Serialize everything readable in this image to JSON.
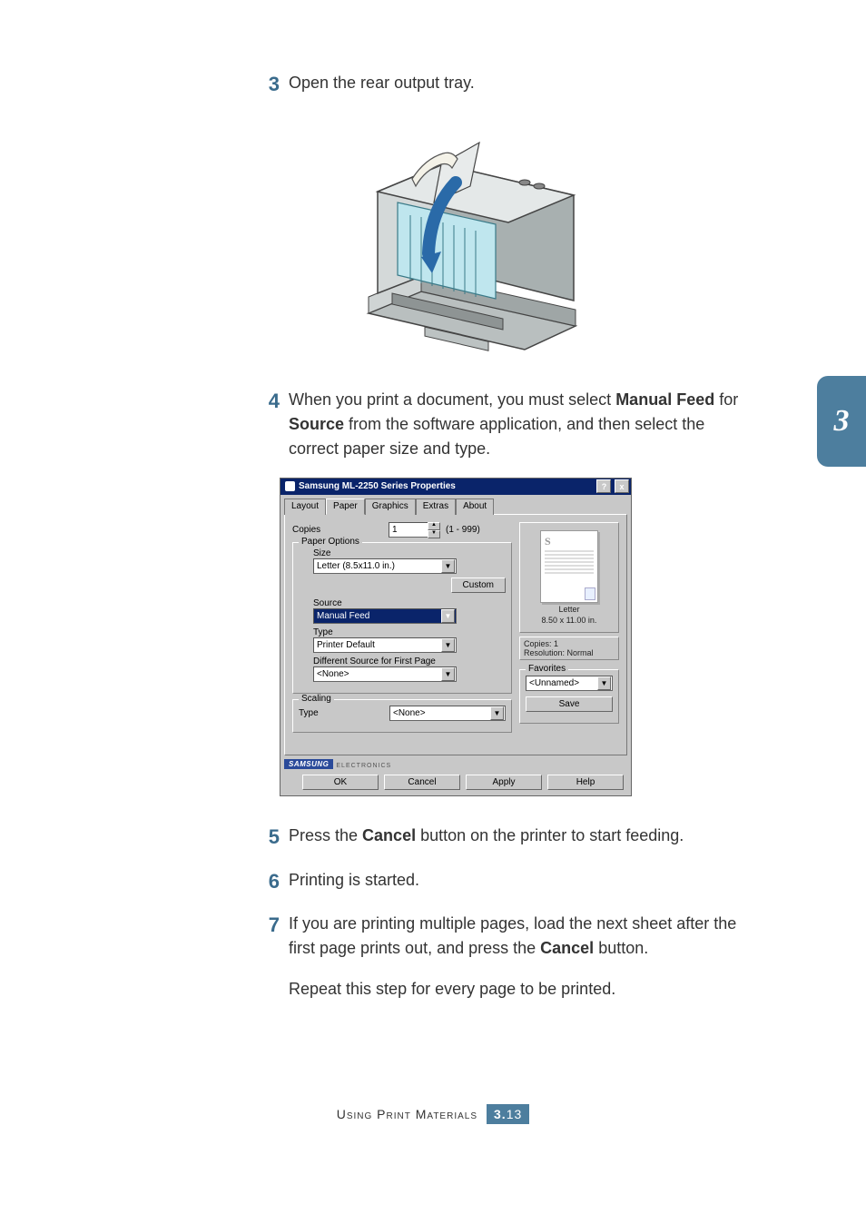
{
  "sideTab": "3",
  "steps": {
    "s3": {
      "num": "3",
      "text": "Open the rear output tray."
    },
    "s4": {
      "num": "4",
      "pre": "When you print a document, you must select ",
      "bold1": "Manual Feed",
      "mid": " for ",
      "bold2": "Source",
      "post": " from the software application, and then select the correct paper size and type."
    },
    "s5": {
      "num": "5",
      "pre": "Press the ",
      "bold": "Cancel",
      "post": " button on the printer to start feeding."
    },
    "s6": {
      "num": "6",
      "text": "Printing is started."
    },
    "s7": {
      "num": "7",
      "pre": "If you are printing multiple pages, load the next sheet after the first page prints out, and press the ",
      "bold": "Cancel",
      "post": " button.",
      "extra": "Repeat this step for every page to be printed."
    }
  },
  "dialog": {
    "title": "Samsung ML-2250 Series Properties",
    "helpBtn": "?",
    "closeBtn": "x",
    "tabs": {
      "layout": "Layout",
      "paper": "Paper",
      "graphics": "Graphics",
      "extras": "Extras",
      "about": "About"
    },
    "copies": {
      "label": "Copies",
      "value": "1",
      "range": "(1 - 999)"
    },
    "paperOptions": {
      "title": "Paper Options",
      "sizeLbl": "Size",
      "sizeVal": "Letter (8.5x11.0 in.)",
      "customBtn": "Custom",
      "sourceLbl": "Source",
      "sourceVal": "Manual Feed",
      "typeLbl": "Type",
      "typeVal": "Printer Default",
      "diffLbl": "Different Source for First Page",
      "diffVal": "<None>"
    },
    "scaling": {
      "title": "Scaling",
      "typeLbl": "Type",
      "typeVal": "<None>"
    },
    "preview": {
      "s": "S",
      "paperName": "Letter",
      "paperDim": "8.50 x 11.00 in.",
      "copies": "Copies: 1",
      "res": "Resolution: Normal"
    },
    "favorites": {
      "title": "Favorites",
      "value": "<Unnamed>",
      "saveBtn": "Save"
    },
    "brand": {
      "samsung": "SAMSUNG",
      "elec": "ELECTRONICS"
    },
    "buttons": {
      "ok": "OK",
      "cancel": "Cancel",
      "apply": "Apply",
      "help": "Help"
    }
  },
  "footer": {
    "section": "Using Print Materials",
    "chapter": "3.",
    "page": "13"
  }
}
